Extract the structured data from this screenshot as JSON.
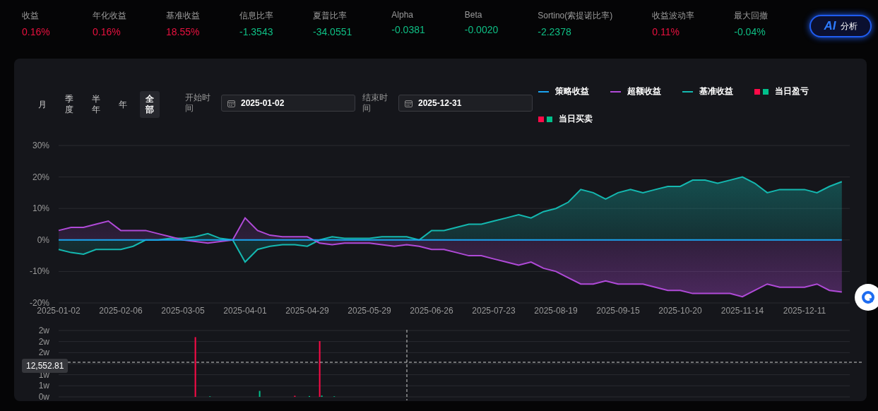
{
  "metrics": [
    {
      "label": "收益",
      "value": "0.16%",
      "color": "#e8113f"
    },
    {
      "label": "年化收益",
      "value": "0.16%",
      "color": "#e8113f"
    },
    {
      "label": "基准收益",
      "value": "18.55%",
      "color": "#e8113f"
    },
    {
      "label": "信息比率",
      "value": "-1.3543",
      "color": "#0fbf85"
    },
    {
      "label": "夏普比率",
      "value": "-34.0551",
      "color": "#0fbf85"
    },
    {
      "label": "Alpha",
      "value": "-0.0381",
      "color": "#0fbf85"
    },
    {
      "label": "Beta",
      "value": "-0.0020",
      "color": "#0fbf85"
    },
    {
      "label": "Sortino(索提诺比率)",
      "value": "-2.2378",
      "color": "#0fbf85"
    },
    {
      "label": "收益波动率",
      "value": "0.11%",
      "color": "#e8113f"
    },
    {
      "label": "最大回撤",
      "value": "-0.04%",
      "color": "#0fbf85"
    }
  ],
  "ai_button": {
    "badge": "AI",
    "label": "分析"
  },
  "periods": [
    {
      "label": "月",
      "selected": false
    },
    {
      "label": "季度",
      "selected": false
    },
    {
      "label": "半年",
      "selected": false
    },
    {
      "label": "年",
      "selected": false
    },
    {
      "label": "全部",
      "selected": true
    }
  ],
  "date_range": [
    {
      "label": "开始时间",
      "value": "2025-01-02"
    },
    {
      "label": "结束时间",
      "value": "2025-12-31"
    }
  ],
  "legend_extra": [
    {
      "label": "当日盈亏",
      "swatches": [
        {
          "color": "#ff0a48"
        },
        {
          "color": "#00c08b"
        }
      ]
    },
    {
      "label": "当日买卖",
      "swatches": [
        {
          "color": "#ff0a48"
        },
        {
          "color": "#00c08b"
        }
      ]
    }
  ],
  "returns_chart": {
    "chart_data": {
      "type": "line",
      "grid": true,
      "categories": [
        "2025-01-02",
        null,
        null,
        null,
        null,
        "2025-02-06",
        null,
        null,
        null,
        null,
        "2025-03-05",
        null,
        null,
        null,
        null,
        "2025-04-01",
        null,
        null,
        null,
        null,
        "2025-04-29",
        null,
        null,
        null,
        null,
        "2025-05-29",
        null,
        null,
        null,
        null,
        "2025-06-26",
        null,
        null,
        null,
        null,
        "2025-07-23",
        null,
        null,
        null,
        null,
        "2025-08-19",
        null,
        null,
        null,
        null,
        "2025-09-15",
        null,
        null,
        null,
        null,
        "2025-10-20",
        null,
        null,
        null,
        null,
        "2025-11-14",
        null,
        null,
        null,
        null,
        "2025-12-11",
        null,
        null,
        null
      ],
      "ylim": [
        -20,
        30
      ],
      "yticks": [
        {
          "value": 30,
          "label": "30%"
        },
        {
          "value": 20,
          "label": "20%"
        },
        {
          "value": 10,
          "label": "10%"
        },
        {
          "value": 0,
          "label": "0%"
        },
        {
          "value": -10,
          "label": "-10%"
        },
        {
          "value": -20,
          "label": "-20%"
        }
      ],
      "series": [
        {
          "name": "策略收益",
          "color": "#1aa3f0",
          "values": [
            0,
            0,
            0,
            0,
            0,
            0,
            0,
            0,
            0,
            0,
            0,
            0,
            0,
            0,
            0,
            0,
            0,
            0,
            0,
            0,
            0,
            0,
            0,
            0,
            0,
            0,
            0,
            0,
            0,
            0,
            0,
            0,
            0,
            0,
            0,
            0,
            0,
            0,
            0,
            0,
            0,
            0,
            0,
            0,
            0,
            0,
            0,
            0,
            0,
            0,
            0,
            0,
            0,
            0,
            0,
            0,
            0,
            0,
            0,
            0,
            0,
            0,
            0,
            0
          ]
        },
        {
          "name": "超额收益",
          "color": "#b04ad8",
          "values": [
            3,
            4,
            4,
            5,
            6,
            3,
            3,
            3,
            2,
            1,
            0,
            -0.5,
            -1,
            -0.5,
            0,
            7,
            3,
            1.5,
            1,
            1,
            1,
            -1,
            -1.5,
            -1,
            -1,
            -1,
            -1.5,
            -2,
            -1.5,
            -2,
            -3,
            -3,
            -4,
            -5,
            -5,
            -6,
            -7,
            -8,
            -7,
            -9,
            -10,
            -12,
            -14,
            -14,
            -13,
            -14,
            -14,
            -14,
            -15,
            -16,
            -16,
            -17,
            -17,
            -17,
            -17,
            -18,
            -16,
            -14,
            -15,
            -15,
            -15,
            -14,
            -16,
            -16.5
          ]
        },
        {
          "name": "基准收益",
          "color": "#14b8b0",
          "values": [
            -3,
            -4,
            -4.5,
            -3,
            -3,
            -3,
            -2,
            0,
            0,
            0.5,
            0.5,
            1,
            2,
            0.5,
            0,
            -7,
            -3,
            -2,
            -1.5,
            -1.5,
            -2,
            0,
            1,
            0.5,
            0.5,
            0.5,
            1,
            1,
            1,
            0,
            3,
            3,
            4,
            5,
            5,
            6,
            7,
            8,
            7,
            9,
            10,
            12,
            16,
            15,
            13,
            15,
            16,
            15,
            16,
            17,
            17,
            19,
            19,
            18,
            19,
            20,
            18,
            15,
            16,
            16,
            16,
            15,
            17,
            18.5
          ]
        }
      ]
    }
  },
  "pnl_chart": {
    "y_axis_labels": [
      "2w",
      "2w",
      "2w",
      "1w",
      "1w",
      "0w"
    ],
    "pointer": {
      "label": "12,552.81"
    }
  }
}
